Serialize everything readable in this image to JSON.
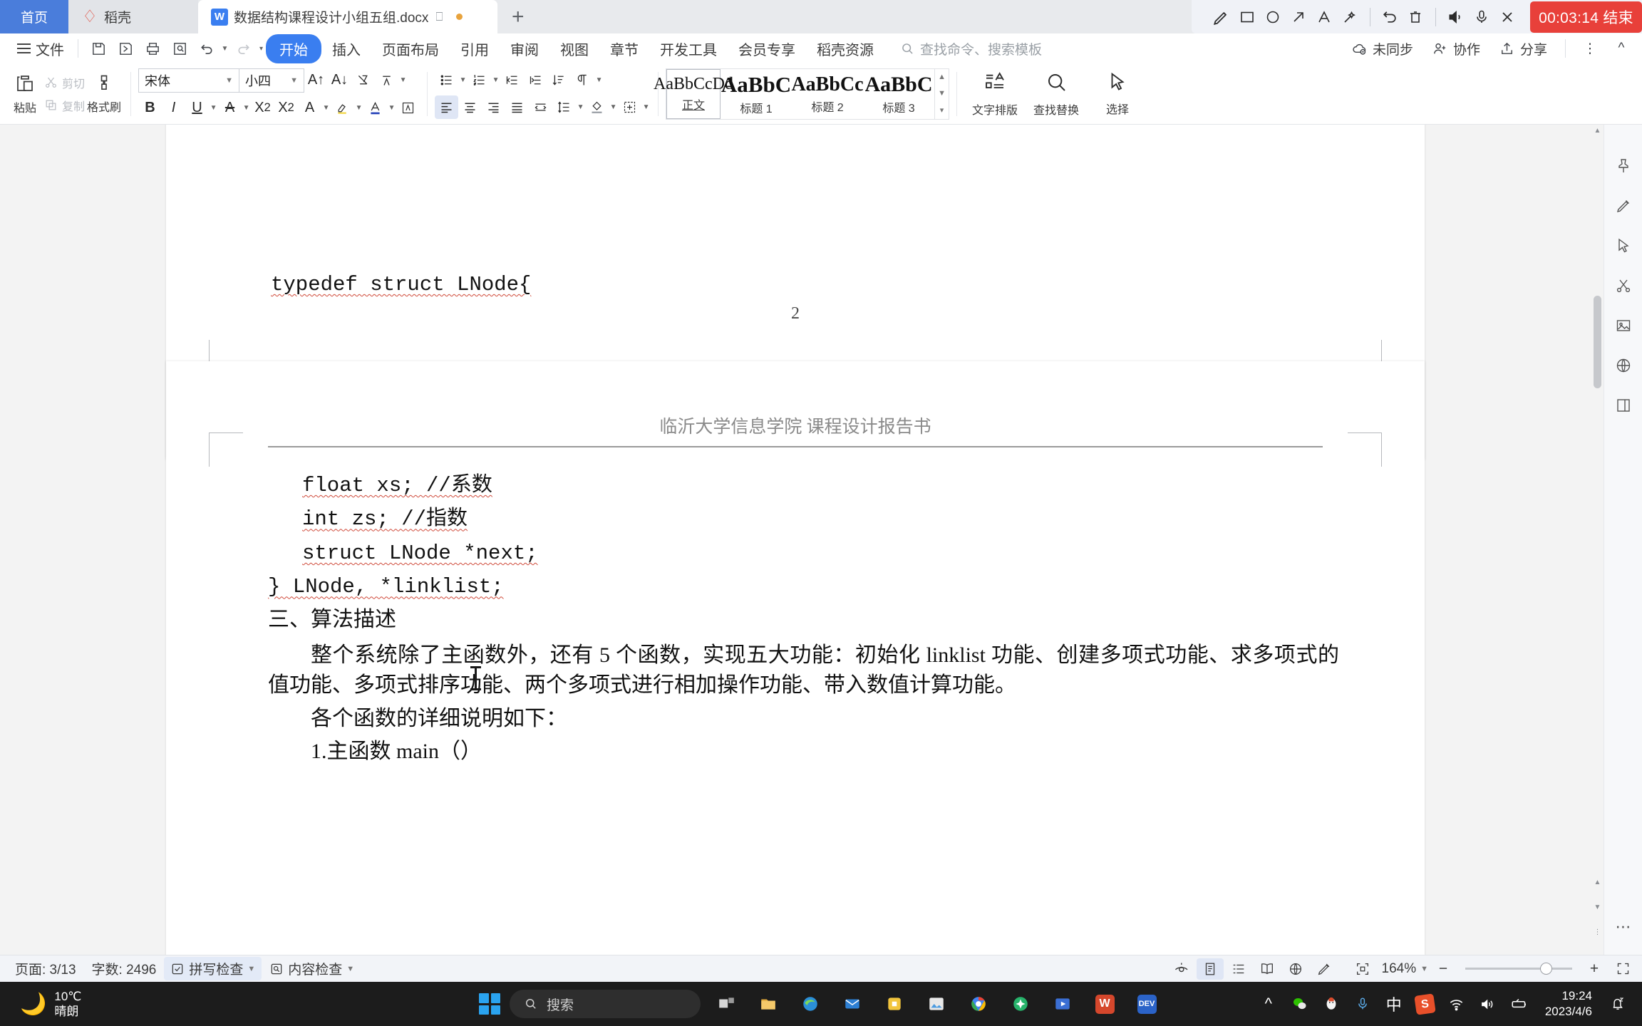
{
  "tabs": [
    {
      "label": "首页",
      "icon": "home-tab"
    },
    {
      "label": "稻壳",
      "icon": "daoke-icon"
    },
    {
      "label": "数据结构课程设计小组五组.docx",
      "icon": "wps-w-icon"
    }
  ],
  "tab_new_label": "+",
  "recorder": {
    "tools": [
      "pen-icon",
      "rectangle-icon",
      "ellipse-icon",
      "arrow-icon",
      "text-icon",
      "magic-wand-icon",
      "undo-icon",
      "trash-icon",
      "speaker-icon",
      "microphone-icon",
      "close-icon"
    ],
    "timer": "00:03:14 结束",
    "timer_color": "#e8403a"
  },
  "menubar": {
    "file_label": "文件",
    "quick_access": [
      "save-icon",
      "save-as-icon",
      "print-icon",
      "print-preview-icon",
      "undo-icon",
      "redo-icon",
      "customize-icon"
    ],
    "items": [
      {
        "label": "开始",
        "active": true
      },
      {
        "label": "插入",
        "active": false
      },
      {
        "label": "页面布局",
        "active": false
      },
      {
        "label": "引用",
        "active": false
      },
      {
        "label": "审阅",
        "active": false
      },
      {
        "label": "视图",
        "active": false
      },
      {
        "label": "章节",
        "active": false
      },
      {
        "label": "开发工具",
        "active": false
      },
      {
        "label": "会员专享",
        "active": false
      },
      {
        "label": "稻壳资源",
        "active": false
      }
    ],
    "search_placeholder": "查找命令、搜索模板",
    "right": [
      {
        "label": "未同步",
        "icon": "cloud-off-icon"
      },
      {
        "label": "协作",
        "icon": "collaborate-icon"
      },
      {
        "label": "分享",
        "icon": "share-icon"
      }
    ],
    "more_icon": "more-vertical-icon",
    "collapse_icon": "chevron-up-icon"
  },
  "ribbon": {
    "paste_label": "粘贴",
    "cut_label": "剪切",
    "copy_label": "复制",
    "format_painter_label": "格式刷",
    "font_name": "宋体",
    "font_size": "小四",
    "styles": [
      {
        "preview": "AaBbCcDd",
        "label": "正文",
        "selected": true
      },
      {
        "preview": "AaBbC",
        "label": "标题 1",
        "selected": false
      },
      {
        "preview": "AaBbCc",
        "label": "标题 2",
        "selected": false
      },
      {
        "preview": "AaBbC",
        "label": "标题 3",
        "selected": false
      }
    ],
    "text_layout_label": "文字排版",
    "find_replace_label": "查找替换",
    "select_label": "选择"
  },
  "document": {
    "page1": {
      "code_line": "typedef struct LNode{",
      "page_number": "2"
    },
    "page2": {
      "header": "临沂大学信息学院  课程设计报告书",
      "lines": [
        "float xs; //系数",
        "int zs;   //指数",
        "struct LNode *next;",
        "} LNode, *linklist;"
      ],
      "heading": "三、算法描述",
      "paragraphs": [
        "整个系统除了主函数外，还有 5 个函数，实现五大功能：初始化 linklist 功能、创建多项式功能、求多项式的值功能、多项式排序功能、两个多项式进行相加操作功能、带入数值计算功能。",
        "各个函数的详细说明如下：",
        "1.主函数 main（）"
      ]
    }
  },
  "statusbar": {
    "page_info": "页面: 3/13",
    "word_count": "字数: 2496",
    "spellcheck_label": "拼写检查",
    "contentcheck_label": "内容检查",
    "zoom_level": "164%",
    "view_icons": [
      "focus-eye-icon",
      "page-view-icon",
      "outline-view-icon",
      "read-view-icon",
      "web-view-icon",
      "edit-pen-icon",
      "fit-page-icon"
    ],
    "zoom_out_icon": "minus-icon",
    "zoom_in_icon": "plus-icon",
    "fullscreen_icon": "expand-icon"
  },
  "taskbar": {
    "weather_temp": "10℃",
    "weather_desc": "晴朗",
    "search_placeholder": "搜索",
    "clock_time": "19:24",
    "clock_date": "2023/4/6",
    "ime_label": "中",
    "apps": [
      "task-view-icon",
      "file-explorer-icon",
      "edge-icon",
      "mail-icon",
      "store-icon",
      "photos-icon",
      "chrome-icon",
      "spark-icon",
      "media-icon",
      "wps-icon",
      "dev-icon"
    ],
    "tray": [
      "chevron-up-icon",
      "wechat-icon",
      "qq-icon",
      "microphone-icon",
      "ime-icon",
      "sogou-icon",
      "wifi-icon",
      "volume-icon",
      "battery-icon",
      "notification-icon"
    ]
  }
}
